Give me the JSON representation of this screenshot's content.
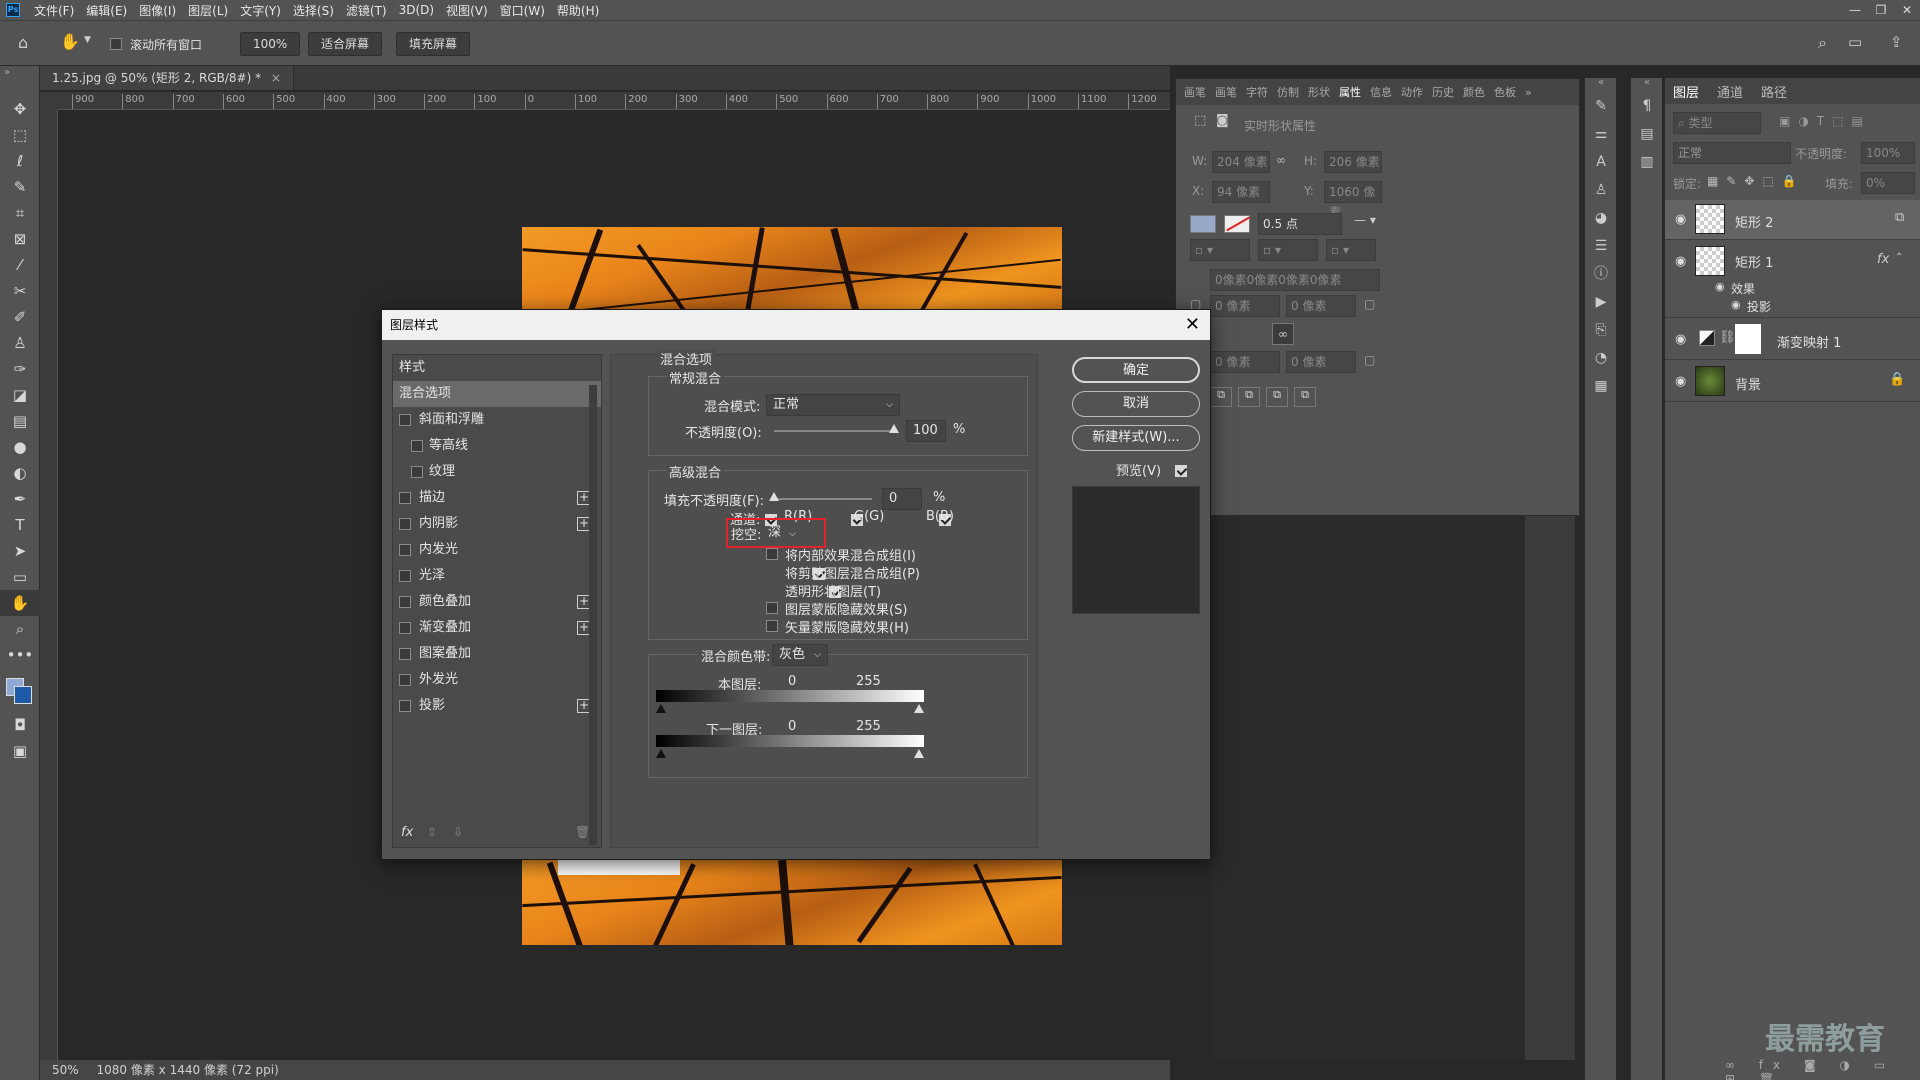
{
  "menubar": {
    "app_icon": "Ps",
    "items": [
      "文件(F)",
      "编辑(E)",
      "图像(I)",
      "图层(L)",
      "文字(Y)",
      "选择(S)",
      "滤镜(T)",
      "3D(D)",
      "视图(V)",
      "窗口(W)",
      "帮助(H)"
    ]
  },
  "options": {
    "scroll_all": "滚动所有窗口",
    "zoom": "100%",
    "fit_screen": "适合屏幕",
    "fill_screen": "填充屏幕"
  },
  "document": {
    "tab_title": "1.25.jpg @ 50% (矩形 2, RGB/8#) *",
    "ruler_ticks": [
      "900",
      "800",
      "700",
      "600",
      "500",
      "400",
      "300",
      "200",
      "100",
      "0",
      "100",
      "200",
      "300",
      "400",
      "500",
      "600",
      "700",
      "800",
      "900",
      "1000",
      "1100",
      "1200"
    ],
    "status_zoom": "50%",
    "status_info": "1080 像素 x 1440 像素 (72 ppi)"
  },
  "properties": {
    "tabs": [
      "画笔",
      "画笔",
      "字符",
      "仿制",
      "形状",
      "属性",
      "信息",
      "动作",
      "历史",
      "颜色",
      "色板"
    ],
    "active_tab": "属性",
    "header": "实时形状属性",
    "w_label": "W:",
    "w_value": "204 像素",
    "h_label": "H:",
    "h_value": "206 像素",
    "x_label": "X:",
    "x_value": "94 像素",
    "y_label": "Y:",
    "y_value": "1060 像素",
    "stroke_width": "0.5 点",
    "corner_all": "0像素0像素0像素0像素",
    "corner_1": "0 像素",
    "corner_2": "0 像素",
    "corner_3": "0 像素",
    "corner_4": "0 像素"
  },
  "layers": {
    "tabs": [
      "图层",
      "通道",
      "路径"
    ],
    "filter_kind": "类型",
    "blend_mode": "正常",
    "opacity_label": "不透明度:",
    "opacity_value": "100%",
    "lock_label": "锁定:",
    "fill_label": "填充:",
    "fill_value": "0%",
    "items": [
      {
        "name": "矩形 2"
      },
      {
        "name": "矩形 1"
      },
      {
        "name": "渐变映射 1"
      },
      {
        "name": "背景"
      }
    ],
    "effects_label": "效果",
    "effect_shadow": "投影",
    "watermark": "最需教育"
  },
  "dialog": {
    "title": "图层样式",
    "styles_header": "样式",
    "styles": [
      {
        "label": "混合选项",
        "checkbox": false,
        "plus": false,
        "selected": true
      },
      {
        "label": "斜面和浮雕",
        "checkbox": true,
        "plus": false
      },
      {
        "label": "等高线",
        "checkbox": true,
        "plus": false,
        "indent": true
      },
      {
        "label": "纹理",
        "checkbox": true,
        "plus": false,
        "indent": true
      },
      {
        "label": "描边",
        "checkbox": true,
        "plus": true
      },
      {
        "label": "内阴影",
        "checkbox": true,
        "plus": true
      },
      {
        "label": "内发光",
        "checkbox": true,
        "plus": false
      },
      {
        "label": "光泽",
        "checkbox": true,
        "plus": false
      },
      {
        "label": "颜色叠加",
        "checkbox": true,
        "plus": true
      },
      {
        "label": "渐变叠加",
        "checkbox": true,
        "plus": true
      },
      {
        "label": "图案叠加",
        "checkbox": true,
        "plus": false
      },
      {
        "label": "外发光",
        "checkbox": true,
        "plus": false
      },
      {
        "label": "投影",
        "checkbox": true,
        "plus": true
      }
    ],
    "fx_label": "fx",
    "blend_options_title": "混合选项",
    "general_title": "常规混合",
    "blend_mode_label": "混合模式:",
    "blend_mode_value": "正常",
    "opacity_label": "不透明度(O):",
    "opacity_value": "100",
    "opacity_level": 1.0,
    "percent": "%",
    "advanced_title": "高级混合",
    "fill_opacity_label": "填充不透明度(F):",
    "fill_opacity_value": "0",
    "fill_opacity_level": 0.0,
    "channels_label": "通道:",
    "channel_r": "R(R)",
    "channel_g": "G(G)",
    "channel_b": "B(B)",
    "knockout_label": "挖空:",
    "knockout_value": "深",
    "options": [
      {
        "label": "将内部效果混合成组(I)",
        "checked": false
      },
      {
        "label": "将剪贴图层混合成组(P)",
        "checked": true
      },
      {
        "label": "透明形状图层(T)",
        "checked": true
      },
      {
        "label": "图层蒙版隐藏效果(S)",
        "checked": false
      },
      {
        "label": "矢量蒙版隐藏效果(H)",
        "checked": false
      }
    ],
    "blend_if_label": "混合颜色带:",
    "blend_if_value": "灰色",
    "this_layer_label": "本图层:",
    "this_layer_min": "0",
    "this_layer_max": "255",
    "under_layer_label": "下一图层:",
    "under_layer_min": "0",
    "under_layer_max": "255",
    "ok": "确定",
    "cancel": "取消",
    "new_style": "新建样式(W)...",
    "preview": "预览(V)"
  },
  "colors": {
    "highlight_box": "#e0242a",
    "foreground": "#8fa8d6",
    "background_swatch": "#1e5aa8"
  }
}
